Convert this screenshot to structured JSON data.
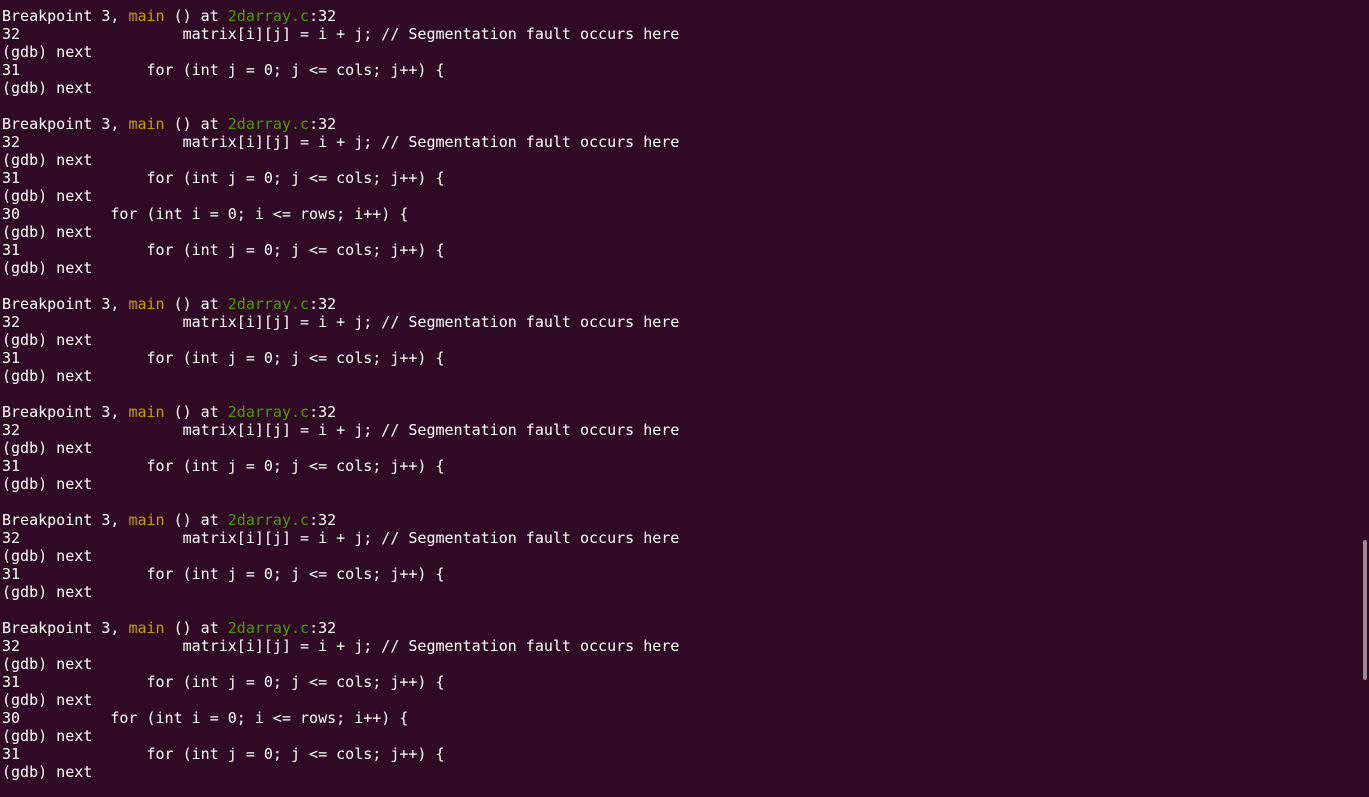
{
  "terminal": {
    "lines": [
      {
        "type": "bp",
        "pre": "Breakpoint 3, ",
        "fn": "main",
        "mid": " () at ",
        "file": "2darray.c",
        "post": ":32"
      },
      {
        "type": "text",
        "text": "32\t\t    matrix[i][j] = i + j; // Segmentation fault occurs here"
      },
      {
        "type": "text",
        "text": "(gdb) next"
      },
      {
        "type": "text",
        "text": "31\t        for (int j = 0; j <= cols; j++) {"
      },
      {
        "type": "text",
        "text": "(gdb) next"
      },
      {
        "type": "text",
        "text": ""
      },
      {
        "type": "bp",
        "pre": "Breakpoint 3, ",
        "fn": "main",
        "mid": " () at ",
        "file": "2darray.c",
        "post": ":32"
      },
      {
        "type": "text",
        "text": "32\t\t    matrix[i][j] = i + j; // Segmentation fault occurs here"
      },
      {
        "type": "text",
        "text": "(gdb) next"
      },
      {
        "type": "text",
        "text": "31\t        for (int j = 0; j <= cols; j++) {"
      },
      {
        "type": "text",
        "text": "(gdb) next"
      },
      {
        "type": "text",
        "text": "30\t    for (int i = 0; i <= rows; i++) {"
      },
      {
        "type": "text",
        "text": "(gdb) next"
      },
      {
        "type": "text",
        "text": "31\t        for (int j = 0; j <= cols; j++) {"
      },
      {
        "type": "text",
        "text": "(gdb) next"
      },
      {
        "type": "text",
        "text": ""
      },
      {
        "type": "bp",
        "pre": "Breakpoint 3, ",
        "fn": "main",
        "mid": " () at ",
        "file": "2darray.c",
        "post": ":32"
      },
      {
        "type": "text",
        "text": "32\t\t    matrix[i][j] = i + j; // Segmentation fault occurs here"
      },
      {
        "type": "text",
        "text": "(gdb) next"
      },
      {
        "type": "text",
        "text": "31\t        for (int j = 0; j <= cols; j++) {"
      },
      {
        "type": "text",
        "text": "(gdb) next"
      },
      {
        "type": "text",
        "text": ""
      },
      {
        "type": "bp",
        "pre": "Breakpoint 3, ",
        "fn": "main",
        "mid": " () at ",
        "file": "2darray.c",
        "post": ":32"
      },
      {
        "type": "text",
        "text": "32\t\t    matrix[i][j] = i + j; // Segmentation fault occurs here"
      },
      {
        "type": "text",
        "text": "(gdb) next"
      },
      {
        "type": "text",
        "text": "31\t        for (int j = 0; j <= cols; j++) {"
      },
      {
        "type": "text",
        "text": "(gdb) next"
      },
      {
        "type": "text",
        "text": ""
      },
      {
        "type": "bp",
        "pre": "Breakpoint 3, ",
        "fn": "main",
        "mid": " () at ",
        "file": "2darray.c",
        "post": ":32"
      },
      {
        "type": "text",
        "text": "32\t\t    matrix[i][j] = i + j; // Segmentation fault occurs here"
      },
      {
        "type": "text",
        "text": "(gdb) next"
      },
      {
        "type": "text",
        "text": "31\t        for (int j = 0; j <= cols; j++) {"
      },
      {
        "type": "text",
        "text": "(gdb) next"
      },
      {
        "type": "text",
        "text": ""
      },
      {
        "type": "bp",
        "pre": "Breakpoint 3, ",
        "fn": "main",
        "mid": " () at ",
        "file": "2darray.c",
        "post": ":32"
      },
      {
        "type": "text",
        "text": "32\t\t    matrix[i][j] = i + j; // Segmentation fault occurs here"
      },
      {
        "type": "text",
        "text": "(gdb) next"
      },
      {
        "type": "text",
        "text": "31\t        for (int j = 0; j <= cols; j++) {"
      },
      {
        "type": "text",
        "text": "(gdb) next"
      },
      {
        "type": "text",
        "text": "30\t    for (int i = 0; i <= rows; i++) {"
      },
      {
        "type": "text",
        "text": "(gdb) next"
      },
      {
        "type": "text",
        "text": "31\t        for (int j = 0; j <= cols; j++) {"
      },
      {
        "type": "text",
        "text": "(gdb) next"
      }
    ]
  },
  "colors": {
    "background": "#300a24",
    "foreground": "#ffffff",
    "function_name": "#c4a000",
    "file_name": "#4e9a06",
    "scrollbar": "#9a8a96"
  }
}
